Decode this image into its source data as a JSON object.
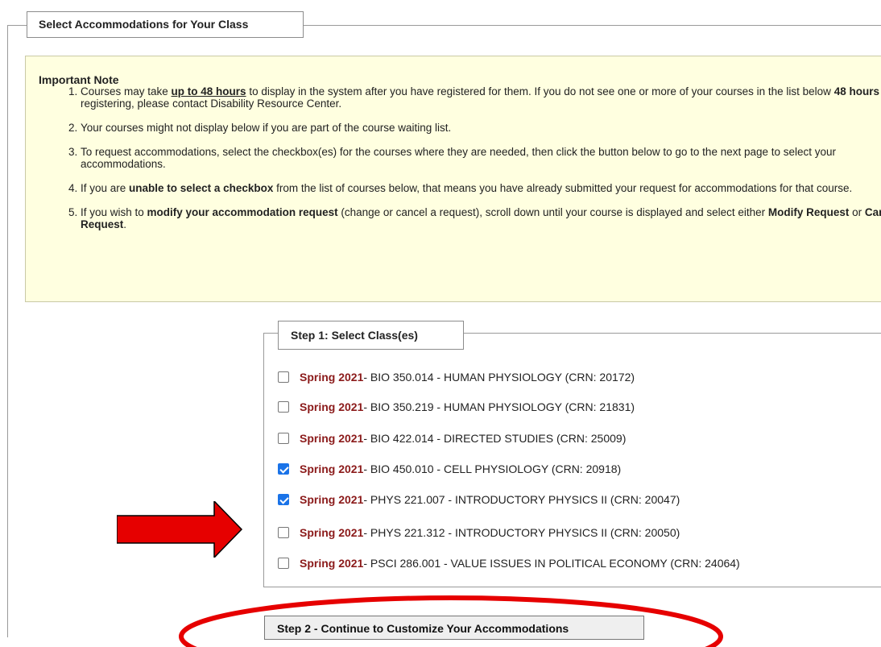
{
  "section": {
    "legend": "Select Accommodations for Your Class"
  },
  "note": {
    "title": "Important Note",
    "items": [
      {
        "p1": "Courses may take ",
        "b1": "up to 48 hours",
        "p2": " to display in the system after you have registered for them. If you do not see one or more of your courses in the list below ",
        "b2": "48 hours",
        "p3": " after registering, please contact Disability Resource Center."
      },
      {
        "text": "Your courses might not display below if you are part of the course waiting list."
      },
      {
        "text": "To request accommodations, select the checkbox(es) for the courses where they are needed, then click the button below to go to the next page to select your accommodations."
      },
      {
        "p1": "If you are ",
        "b1": "unable to select a checkbox",
        "p2": " from the list of courses below, that means you have already submitted your request for accommodations for that course."
      },
      {
        "p1": "If you wish to ",
        "b1": "modify your accommodation request",
        "p2": " (change or cancel a request), scroll down until your course is displayed and select either ",
        "b2": "Modify Request",
        "p3": " or ",
        "b3": "Cancel Request",
        "p4": "."
      }
    ]
  },
  "step1": {
    "legend": "Step 1: Select Class(es)",
    "courses": [
      {
        "term": "Spring 2021",
        "detail": " - BIO 350.014 - HUMAN PHYSIOLOGY (CRN: 20172)",
        "checked": false
      },
      {
        "term": "Spring 2021",
        "detail": " - BIO 350.219 - HUMAN PHYSIOLOGY (CRN: 21831)",
        "checked": false
      },
      {
        "term": "Spring 2021",
        "detail": " - BIO 422.014 - DIRECTED STUDIES (CRN: 25009)",
        "checked": false
      },
      {
        "term": "Spring 2021",
        "detail": " - BIO 450.010 - CELL PHYSIOLOGY (CRN: 20918)",
        "checked": true
      },
      {
        "term": "Spring 2021",
        "detail": " - PHYS 221.007 - INTRODUCTORY PHYSICS II (CRN: 20047)",
        "checked": true
      },
      {
        "term": "Spring 2021",
        "detail": " - PHYS 221.312 - INTRODUCTORY PHYSICS II (CRN: 20050)",
        "checked": false
      },
      {
        "term": "Spring 2021",
        "detail": " - PSCI 286.001 - VALUE ISSUES IN POLITICAL ECONOMY (CRN: 24064)",
        "checked": false
      }
    ]
  },
  "step2": {
    "button_label": "Step 2 - Continue to Customize Your Accommodations"
  },
  "annotations": {
    "arrow_color": "#e60000",
    "ellipse_color": "#e60000",
    "checkbox_color": "#1a73e8",
    "term_color": "#8b1a1a"
  }
}
